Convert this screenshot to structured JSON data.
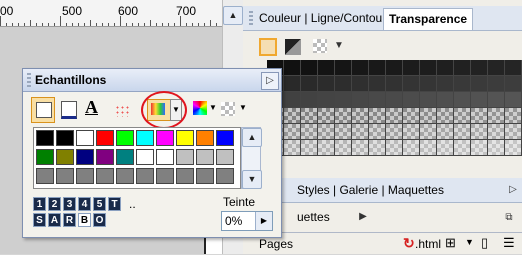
{
  "ruler": {
    "labels": [
      "00",
      "500",
      "600",
      "700"
    ]
  },
  "right_panel": {
    "top_tabs": {
      "tab1": "Couleur | Ligne/Contour",
      "tab_active": "Transparence"
    },
    "mid_tabs": {
      "text": "Styles | Galerie | Maquettes"
    },
    "maquettes_row": "uettes",
    "pages": {
      "label": "Pages",
      "html_label": ".html"
    }
  },
  "swatches_panel": {
    "title": "Echantillons",
    "text_icon": "A",
    "tint_label": "Teinte",
    "tint_value": "0%",
    "ellipsis": "..",
    "letters_top": [
      "1",
      "2",
      "3",
      "4",
      "5",
      "T"
    ],
    "letters_bottom": [
      "S",
      "A",
      "R",
      "B",
      "O"
    ],
    "palette_rows": [
      [
        "#000000",
        "#000000",
        "#ffffff",
        "#ff0000",
        "#00ff00",
        "#00ffff",
        "#ff00ff",
        "#ffff00",
        "#ff8000",
        "#0000ff"
      ],
      [
        "#008000",
        "#808000",
        "#000080",
        "#800080",
        "#008080",
        "#ffffff",
        "#ffffff",
        "#c0c0c0",
        "#c0c0c0",
        "#c0c0c0"
      ],
      [
        "#808080",
        "#808080",
        "#808080",
        "#808080",
        "#808080",
        "#808080",
        "#808080",
        "#808080",
        "#808080",
        "#808080"
      ]
    ]
  },
  "colors": {
    "highlight_circle": "#e0141e",
    "accent": "#316ac5"
  }
}
